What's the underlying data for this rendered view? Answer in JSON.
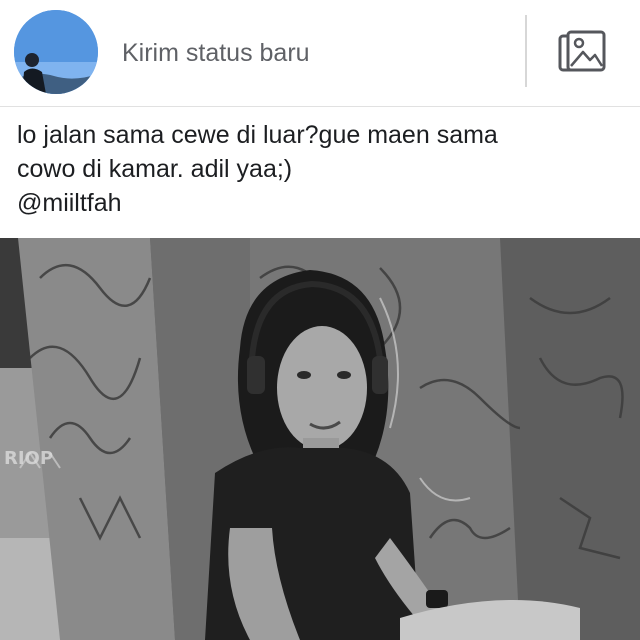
{
  "composer": {
    "prompt": "Kirim status baru",
    "avatar_icon": "profile-avatar",
    "photo_icon": "photo-gallery-icon"
  },
  "post": {
    "lines": [
      "lo jalan sama cewe di luar?gue maen sama",
      "cowo di kamar. adil yaa;)",
      "@miiltfah"
    ],
    "photo": {
      "style": "black-and-white",
      "wall_text": "RIOP"
    }
  },
  "colors": {
    "background": "#ffffff",
    "prompt_text": "#5f6166",
    "post_text": "#1c1e21",
    "divider": "#d7d7d7"
  }
}
